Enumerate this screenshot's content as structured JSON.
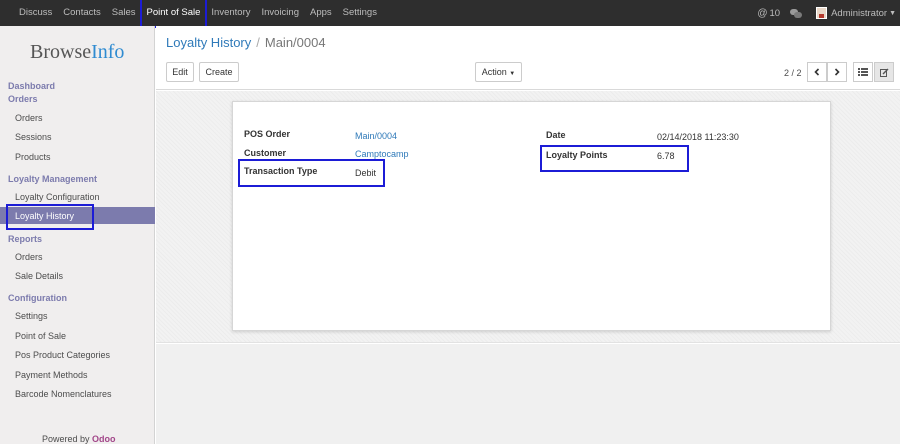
{
  "topbar": {
    "menu": [
      "Discuss",
      "Contacts",
      "Sales",
      "Point of Sale",
      "Inventory",
      "Invoicing",
      "Apps",
      "Settings"
    ],
    "messages_count": "10",
    "user": "Administrator"
  },
  "sidebar": {
    "logo_part1": "Browse",
    "logo_part2": "Info",
    "sections": {
      "dashboard": "Dashboard",
      "orders": "Orders",
      "loyalty_management": "Loyalty Management",
      "reports": "Reports",
      "configuration": "Configuration"
    },
    "orders_items": [
      "Orders",
      "Sessions",
      "Products"
    ],
    "loyalty_items": [
      "Loyalty Configuration",
      "Loyalty History"
    ],
    "reports_items": [
      "Orders",
      "Sale Details"
    ],
    "config_items": [
      "Settings",
      "Point of Sale",
      "Pos Product Categories",
      "Payment Methods",
      "Barcode Nomenclatures"
    ],
    "powered_by": "Powered by",
    "powered_brand": "Odoo"
  },
  "breadcrumb": {
    "parent": "Loyalty History",
    "separator": "/",
    "current": "Main/0004"
  },
  "toolbar": {
    "edit_label": "Edit",
    "create_label": "Create",
    "action_label": "Action",
    "pager": "2 / 2"
  },
  "form": {
    "pos_order_label": "POS Order",
    "pos_order_value": "Main/0004",
    "customer_label": "Customer",
    "customer_value": "Camptocamp",
    "transaction_type_label": "Transaction Type",
    "transaction_type_value": "Debit",
    "date_label": "Date",
    "date_value": "02/14/2018 11:23:30",
    "loyalty_points_label": "Loyalty Points",
    "loyalty_points_value": "6.78"
  },
  "colors": {
    "accent": "#7c7bad",
    "link": "#2f7ab9",
    "highlight_box": "#1c1cd6",
    "topbar": "#2e2e2e"
  }
}
